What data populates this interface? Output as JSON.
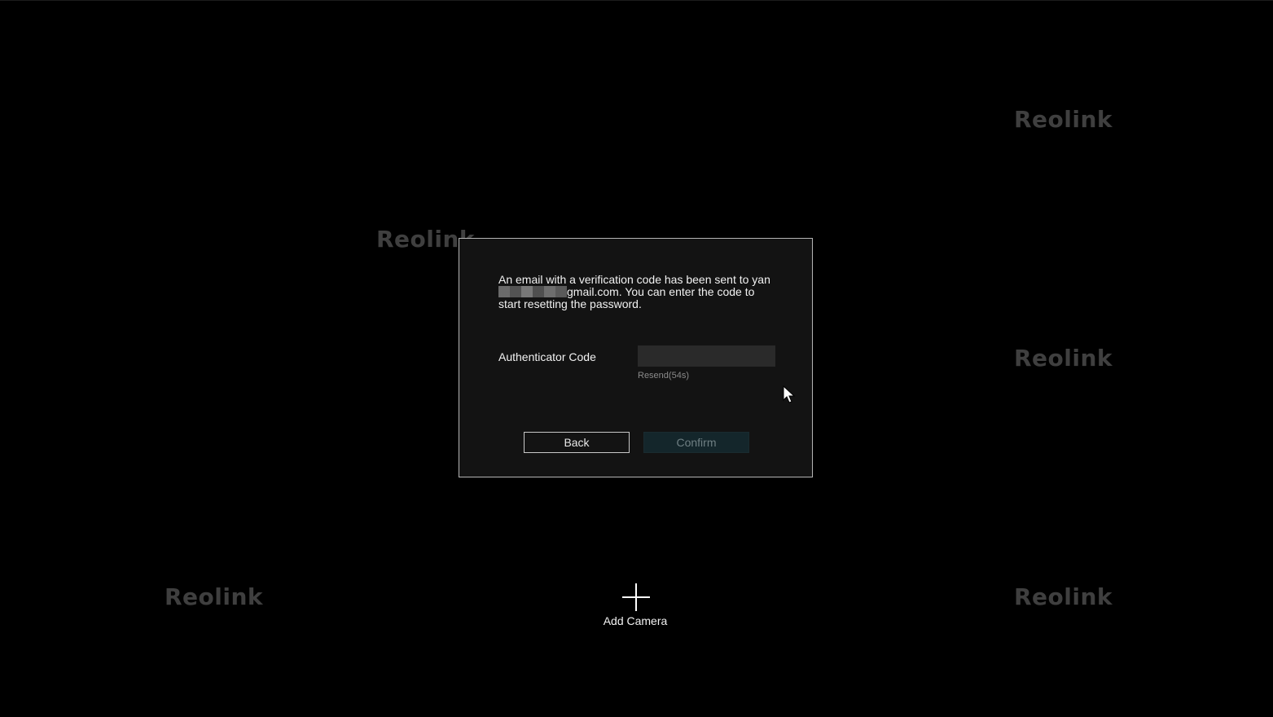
{
  "watermarks": [
    "Reolink",
    "Reolink",
    "Reolink",
    "Reolink",
    "Reolink"
  ],
  "dialog": {
    "message_part1": "An email with a verification code has been sent to yan",
    "message_part2": "gmail.com. You can enter the code to start resetting the password.",
    "auth_label": "Authenticator Code",
    "code_input_value": "",
    "resend_label": "Resend(54s)",
    "back_label": "Back",
    "confirm_label": "Confirm"
  },
  "add_camera": {
    "label": "Add Camera",
    "icon": "plus-icon"
  },
  "colors": {
    "background": "#000000",
    "dialog_bg": "#131313",
    "confirm_disabled_bg": "#14262b",
    "watermark": "#3f3f3f"
  }
}
